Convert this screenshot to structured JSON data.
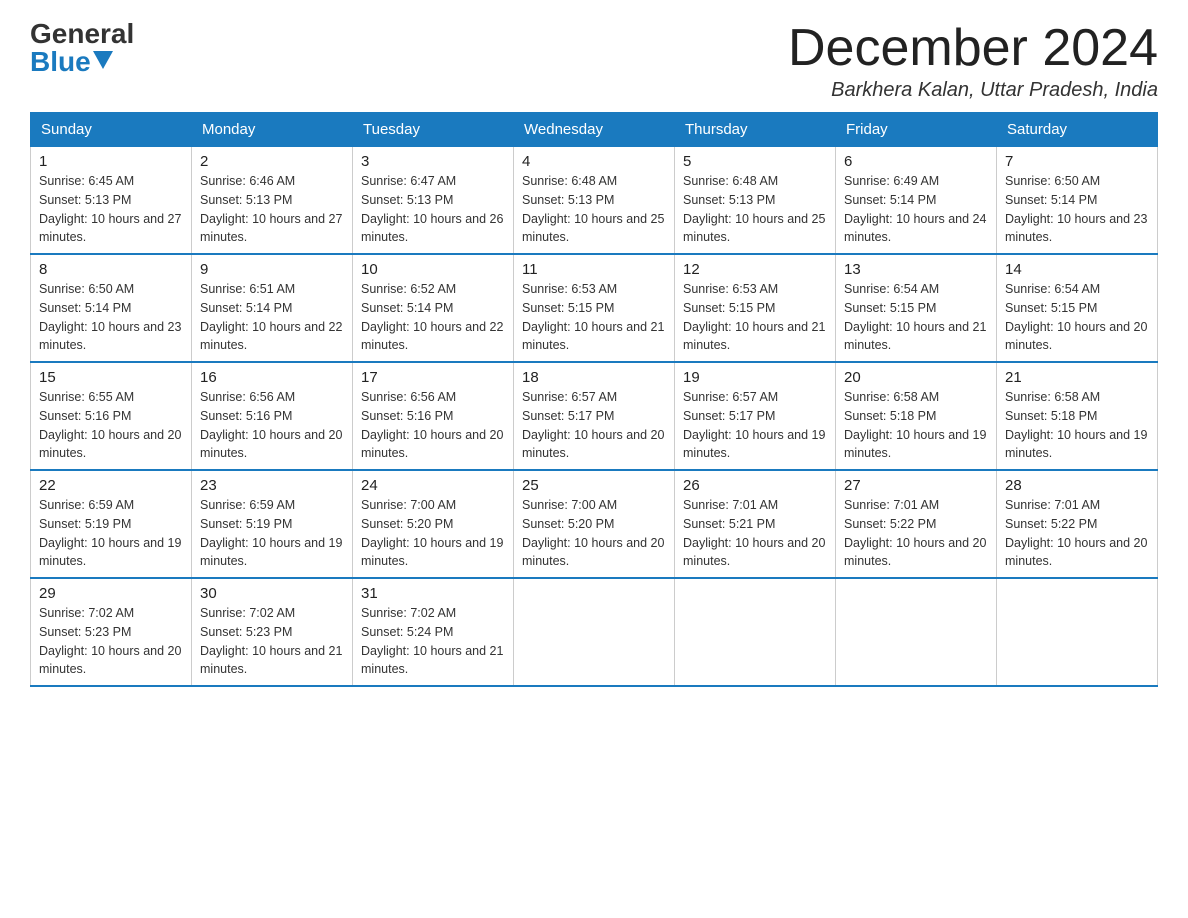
{
  "header": {
    "logo_general": "General",
    "logo_blue": "Blue",
    "month_title": "December 2024",
    "location": "Barkhera Kalan, Uttar Pradesh, India"
  },
  "weekdays": [
    "Sunday",
    "Monday",
    "Tuesday",
    "Wednesday",
    "Thursday",
    "Friday",
    "Saturday"
  ],
  "weeks": [
    [
      {
        "day": "1",
        "sunrise": "6:45 AM",
        "sunset": "5:13 PM",
        "daylight": "10 hours and 27 minutes."
      },
      {
        "day": "2",
        "sunrise": "6:46 AM",
        "sunset": "5:13 PM",
        "daylight": "10 hours and 27 minutes."
      },
      {
        "day": "3",
        "sunrise": "6:47 AM",
        "sunset": "5:13 PM",
        "daylight": "10 hours and 26 minutes."
      },
      {
        "day": "4",
        "sunrise": "6:48 AM",
        "sunset": "5:13 PM",
        "daylight": "10 hours and 25 minutes."
      },
      {
        "day": "5",
        "sunrise": "6:48 AM",
        "sunset": "5:13 PM",
        "daylight": "10 hours and 25 minutes."
      },
      {
        "day": "6",
        "sunrise": "6:49 AM",
        "sunset": "5:14 PM",
        "daylight": "10 hours and 24 minutes."
      },
      {
        "day": "7",
        "sunrise": "6:50 AM",
        "sunset": "5:14 PM",
        "daylight": "10 hours and 23 minutes."
      }
    ],
    [
      {
        "day": "8",
        "sunrise": "6:50 AM",
        "sunset": "5:14 PM",
        "daylight": "10 hours and 23 minutes."
      },
      {
        "day": "9",
        "sunrise": "6:51 AM",
        "sunset": "5:14 PM",
        "daylight": "10 hours and 22 minutes."
      },
      {
        "day": "10",
        "sunrise": "6:52 AM",
        "sunset": "5:14 PM",
        "daylight": "10 hours and 22 minutes."
      },
      {
        "day": "11",
        "sunrise": "6:53 AM",
        "sunset": "5:15 PM",
        "daylight": "10 hours and 21 minutes."
      },
      {
        "day": "12",
        "sunrise": "6:53 AM",
        "sunset": "5:15 PM",
        "daylight": "10 hours and 21 minutes."
      },
      {
        "day": "13",
        "sunrise": "6:54 AM",
        "sunset": "5:15 PM",
        "daylight": "10 hours and 21 minutes."
      },
      {
        "day": "14",
        "sunrise": "6:54 AM",
        "sunset": "5:15 PM",
        "daylight": "10 hours and 20 minutes."
      }
    ],
    [
      {
        "day": "15",
        "sunrise": "6:55 AM",
        "sunset": "5:16 PM",
        "daylight": "10 hours and 20 minutes."
      },
      {
        "day": "16",
        "sunrise": "6:56 AM",
        "sunset": "5:16 PM",
        "daylight": "10 hours and 20 minutes."
      },
      {
        "day": "17",
        "sunrise": "6:56 AM",
        "sunset": "5:16 PM",
        "daylight": "10 hours and 20 minutes."
      },
      {
        "day": "18",
        "sunrise": "6:57 AM",
        "sunset": "5:17 PM",
        "daylight": "10 hours and 20 minutes."
      },
      {
        "day": "19",
        "sunrise": "6:57 AM",
        "sunset": "5:17 PM",
        "daylight": "10 hours and 19 minutes."
      },
      {
        "day": "20",
        "sunrise": "6:58 AM",
        "sunset": "5:18 PM",
        "daylight": "10 hours and 19 minutes."
      },
      {
        "day": "21",
        "sunrise": "6:58 AM",
        "sunset": "5:18 PM",
        "daylight": "10 hours and 19 minutes."
      }
    ],
    [
      {
        "day": "22",
        "sunrise": "6:59 AM",
        "sunset": "5:19 PM",
        "daylight": "10 hours and 19 minutes."
      },
      {
        "day": "23",
        "sunrise": "6:59 AM",
        "sunset": "5:19 PM",
        "daylight": "10 hours and 19 minutes."
      },
      {
        "day": "24",
        "sunrise": "7:00 AM",
        "sunset": "5:20 PM",
        "daylight": "10 hours and 19 minutes."
      },
      {
        "day": "25",
        "sunrise": "7:00 AM",
        "sunset": "5:20 PM",
        "daylight": "10 hours and 20 minutes."
      },
      {
        "day": "26",
        "sunrise": "7:01 AM",
        "sunset": "5:21 PM",
        "daylight": "10 hours and 20 minutes."
      },
      {
        "day": "27",
        "sunrise": "7:01 AM",
        "sunset": "5:22 PM",
        "daylight": "10 hours and 20 minutes."
      },
      {
        "day": "28",
        "sunrise": "7:01 AM",
        "sunset": "5:22 PM",
        "daylight": "10 hours and 20 minutes."
      }
    ],
    [
      {
        "day": "29",
        "sunrise": "7:02 AM",
        "sunset": "5:23 PM",
        "daylight": "10 hours and 20 minutes."
      },
      {
        "day": "30",
        "sunrise": "7:02 AM",
        "sunset": "5:23 PM",
        "daylight": "10 hours and 21 minutes."
      },
      {
        "day": "31",
        "sunrise": "7:02 AM",
        "sunset": "5:24 PM",
        "daylight": "10 hours and 21 minutes."
      },
      null,
      null,
      null,
      null
    ]
  ]
}
